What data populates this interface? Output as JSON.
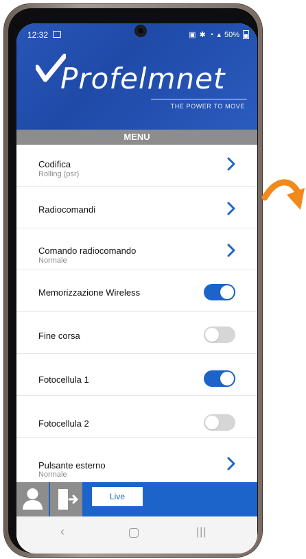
{
  "status_bar": {
    "time": "12:32",
    "battery": "50%"
  },
  "brand": {
    "name": "Profelmnet",
    "tagline": "THE POWER TO MOVE"
  },
  "menu": {
    "title": "MENU"
  },
  "items": [
    {
      "label": "Codifica",
      "sub": "Rolling (psr)",
      "type": "nav",
      "icon": "chevron-right-icon"
    },
    {
      "label": "Radiocomandi",
      "sub": "",
      "type": "nav",
      "icon": "chevron-right-icon"
    },
    {
      "label": "Comando radiocomando",
      "sub": "Normale",
      "type": "nav",
      "icon": "chevron-right-icon"
    },
    {
      "label": "Memorizzazione Wireless",
      "sub": "",
      "type": "toggle",
      "state": 1
    },
    {
      "label": "Fine corsa",
      "sub": "",
      "type": "toggle",
      "state": 0
    },
    {
      "label": "Fotocellula 1",
      "sub": "",
      "type": "toggle",
      "state": 1
    },
    {
      "label": "Fotocellula 2",
      "sub": "",
      "type": "toggle",
      "state": 0
    },
    {
      "label": "Pulsante esterno",
      "sub": "Normale",
      "type": "nav",
      "icon": "chevron-right-icon"
    }
  ],
  "bottom_bar": {
    "live_label": "Live",
    "accent": "#1c64c9"
  },
  "colors": {
    "header_blue": "#2856b8",
    "toggle_on": "#1c64c9",
    "toggle_off": "#d6d6d6",
    "arrow_orange": "#f08a1c"
  }
}
